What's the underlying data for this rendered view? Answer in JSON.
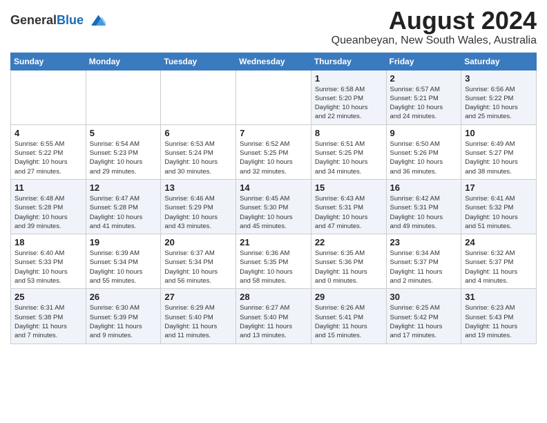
{
  "header": {
    "logo_general": "General",
    "logo_blue": "Blue",
    "month_year": "August 2024",
    "location": "Queanbeyan, New South Wales, Australia"
  },
  "days_of_week": [
    "Sunday",
    "Monday",
    "Tuesday",
    "Wednesday",
    "Thursday",
    "Friday",
    "Saturday"
  ],
  "weeks": [
    [
      {
        "day": "",
        "info": ""
      },
      {
        "day": "",
        "info": ""
      },
      {
        "day": "",
        "info": ""
      },
      {
        "day": "",
        "info": ""
      },
      {
        "day": "1",
        "info": "Sunrise: 6:58 AM\nSunset: 5:20 PM\nDaylight: 10 hours\nand 22 minutes."
      },
      {
        "day": "2",
        "info": "Sunrise: 6:57 AM\nSunset: 5:21 PM\nDaylight: 10 hours\nand 24 minutes."
      },
      {
        "day": "3",
        "info": "Sunrise: 6:56 AM\nSunset: 5:22 PM\nDaylight: 10 hours\nand 25 minutes."
      }
    ],
    [
      {
        "day": "4",
        "info": "Sunrise: 6:55 AM\nSunset: 5:22 PM\nDaylight: 10 hours\nand 27 minutes."
      },
      {
        "day": "5",
        "info": "Sunrise: 6:54 AM\nSunset: 5:23 PM\nDaylight: 10 hours\nand 29 minutes."
      },
      {
        "day": "6",
        "info": "Sunrise: 6:53 AM\nSunset: 5:24 PM\nDaylight: 10 hours\nand 30 minutes."
      },
      {
        "day": "7",
        "info": "Sunrise: 6:52 AM\nSunset: 5:25 PM\nDaylight: 10 hours\nand 32 minutes."
      },
      {
        "day": "8",
        "info": "Sunrise: 6:51 AM\nSunset: 5:25 PM\nDaylight: 10 hours\nand 34 minutes."
      },
      {
        "day": "9",
        "info": "Sunrise: 6:50 AM\nSunset: 5:26 PM\nDaylight: 10 hours\nand 36 minutes."
      },
      {
        "day": "10",
        "info": "Sunrise: 6:49 AM\nSunset: 5:27 PM\nDaylight: 10 hours\nand 38 minutes."
      }
    ],
    [
      {
        "day": "11",
        "info": "Sunrise: 6:48 AM\nSunset: 5:28 PM\nDaylight: 10 hours\nand 39 minutes."
      },
      {
        "day": "12",
        "info": "Sunrise: 6:47 AM\nSunset: 5:28 PM\nDaylight: 10 hours\nand 41 minutes."
      },
      {
        "day": "13",
        "info": "Sunrise: 6:46 AM\nSunset: 5:29 PM\nDaylight: 10 hours\nand 43 minutes."
      },
      {
        "day": "14",
        "info": "Sunrise: 6:45 AM\nSunset: 5:30 PM\nDaylight: 10 hours\nand 45 minutes."
      },
      {
        "day": "15",
        "info": "Sunrise: 6:43 AM\nSunset: 5:31 PM\nDaylight: 10 hours\nand 47 minutes."
      },
      {
        "day": "16",
        "info": "Sunrise: 6:42 AM\nSunset: 5:31 PM\nDaylight: 10 hours\nand 49 minutes."
      },
      {
        "day": "17",
        "info": "Sunrise: 6:41 AM\nSunset: 5:32 PM\nDaylight: 10 hours\nand 51 minutes."
      }
    ],
    [
      {
        "day": "18",
        "info": "Sunrise: 6:40 AM\nSunset: 5:33 PM\nDaylight: 10 hours\nand 53 minutes."
      },
      {
        "day": "19",
        "info": "Sunrise: 6:39 AM\nSunset: 5:34 PM\nDaylight: 10 hours\nand 55 minutes."
      },
      {
        "day": "20",
        "info": "Sunrise: 6:37 AM\nSunset: 5:34 PM\nDaylight: 10 hours\nand 56 minutes."
      },
      {
        "day": "21",
        "info": "Sunrise: 6:36 AM\nSunset: 5:35 PM\nDaylight: 10 hours\nand 58 minutes."
      },
      {
        "day": "22",
        "info": "Sunrise: 6:35 AM\nSunset: 5:36 PM\nDaylight: 11 hours\nand 0 minutes."
      },
      {
        "day": "23",
        "info": "Sunrise: 6:34 AM\nSunset: 5:37 PM\nDaylight: 11 hours\nand 2 minutes."
      },
      {
        "day": "24",
        "info": "Sunrise: 6:32 AM\nSunset: 5:37 PM\nDaylight: 11 hours\nand 4 minutes."
      }
    ],
    [
      {
        "day": "25",
        "info": "Sunrise: 6:31 AM\nSunset: 5:38 PM\nDaylight: 11 hours\nand 7 minutes."
      },
      {
        "day": "26",
        "info": "Sunrise: 6:30 AM\nSunset: 5:39 PM\nDaylight: 11 hours\nand 9 minutes."
      },
      {
        "day": "27",
        "info": "Sunrise: 6:29 AM\nSunset: 5:40 PM\nDaylight: 11 hours\nand 11 minutes."
      },
      {
        "day": "28",
        "info": "Sunrise: 6:27 AM\nSunset: 5:40 PM\nDaylight: 11 hours\nand 13 minutes."
      },
      {
        "day": "29",
        "info": "Sunrise: 6:26 AM\nSunset: 5:41 PM\nDaylight: 11 hours\nand 15 minutes."
      },
      {
        "day": "30",
        "info": "Sunrise: 6:25 AM\nSunset: 5:42 PM\nDaylight: 11 hours\nand 17 minutes."
      },
      {
        "day": "31",
        "info": "Sunrise: 6:23 AM\nSunset: 5:43 PM\nDaylight: 11 hours\nand 19 minutes."
      }
    ]
  ]
}
